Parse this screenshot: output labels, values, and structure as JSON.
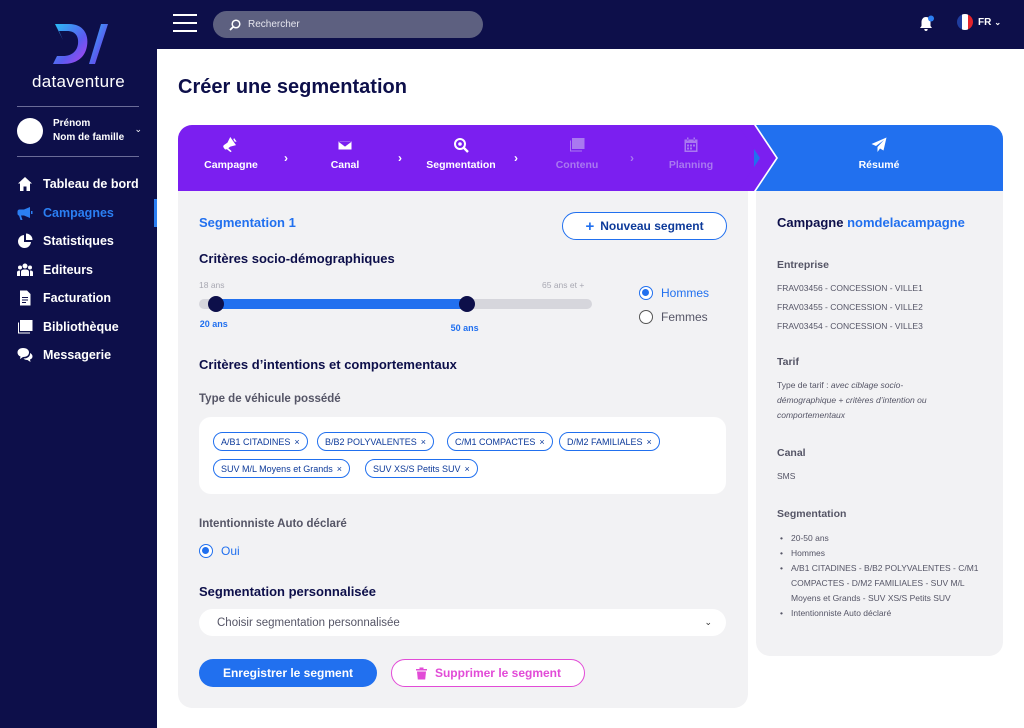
{
  "brand": {
    "name": "dataventure"
  },
  "user": {
    "first_name": "Prénom",
    "last_name": "Nom de famille"
  },
  "nav": [
    {
      "label": "Tableau de bord",
      "icon": "home-icon"
    },
    {
      "label": "Campagnes",
      "icon": "megaphone-icon",
      "active": true
    },
    {
      "label": "Statistiques",
      "icon": "pie-chart-icon"
    },
    {
      "label": "Editeurs",
      "icon": "users-icon"
    },
    {
      "label": "Facturation",
      "icon": "invoice-icon"
    },
    {
      "label": "Bibliothèque",
      "icon": "images-icon"
    },
    {
      "label": "Messagerie",
      "icon": "chat-icon"
    }
  ],
  "topbar": {
    "search_placeholder": "Rechercher",
    "language": "FR"
  },
  "page": {
    "title": "Créer une segmentation"
  },
  "steps": [
    {
      "label": "Campagne",
      "icon": "megaphone-icon",
      "state": "done"
    },
    {
      "label": "Canal",
      "icon": "envelope-icon",
      "state": "done"
    },
    {
      "label": "Segmentation",
      "icon": "search-icon",
      "state": "current"
    },
    {
      "label": "Contenu",
      "icon": "images-icon",
      "state": "disabled"
    },
    {
      "label": "Planning",
      "icon": "calendar-icon",
      "state": "disabled"
    },
    {
      "label": "Résumé",
      "icon": "paper-plane-icon",
      "state": "summary"
    }
  ],
  "segment": {
    "title": "Segmentation 1",
    "new_segment_label": "Nouveau segment",
    "socio_title": "Critères socio-démographiques",
    "age": {
      "min_label": "18 ans",
      "max_label": "65 ans et +",
      "range_min": 18,
      "range_max": 65,
      "value_low": 20,
      "value_high": 50,
      "low_label": "20 ans",
      "high_label": "50 ans"
    },
    "gender_options": [
      {
        "label": "Hommes",
        "selected": true
      },
      {
        "label": "Femmes",
        "selected": false
      }
    ],
    "behavior_title": "Critères d’intentions et comportementaux",
    "vehicle_title": "Type de véhicule possédé",
    "vehicle_tags": [
      "A/B1 CITADINES",
      "B/B2 POLYVALENTES",
      "C/M1 COMPACTES",
      "D/M2 FAMILIALES",
      "SUV M/L Moyens et Grands",
      "SUV XS/S Petits SUV"
    ],
    "intent_title": "Intentionniste Auto déclaré",
    "intent_option": "Oui",
    "custom_title": "Segmentation personnalisée",
    "custom_placeholder": "Choisir segmentation personnalisée",
    "save_label": "Enregistrer le segment",
    "delete_label": "Supprimer le segment"
  },
  "summary": {
    "campaign_prefix": "Campagne",
    "campaign_name": "nomdelacampagne",
    "company_title": "Entreprise",
    "companies": [
      "FRAV03456 - CONCESSION - VILLE1",
      "FRAV03455 - CONCESSION - VILLE2",
      "FRAV03454 - CONCESSION - VILLE3"
    ],
    "tarif_title": "Tarif",
    "tarif_prefix": "Type de tarif : ",
    "tarif_value": "avec ciblage socio-démographique + critères d’intention ou comportementaux",
    "canal_title": "Canal",
    "canal_value": "SMS",
    "segmentation_title": "Segmentation",
    "segmentation_items": [
      "20-50 ans",
      "Hommes",
      "A/B1 CITADINES - B/B2 POLYVALENTES - C/M1 COMPACTES - D/M2 FAMILIALES - SUV M/L Moyens et Grands - SUV XS/S Petits SUV",
      "Intentionniste Auto déclaré"
    ]
  },
  "colors": {
    "navy": "#0d0f4a",
    "blue": "#2170ef",
    "purple": "#7b1ff0",
    "pink": "#e24bd7",
    "panel": "#f2f2f4"
  }
}
